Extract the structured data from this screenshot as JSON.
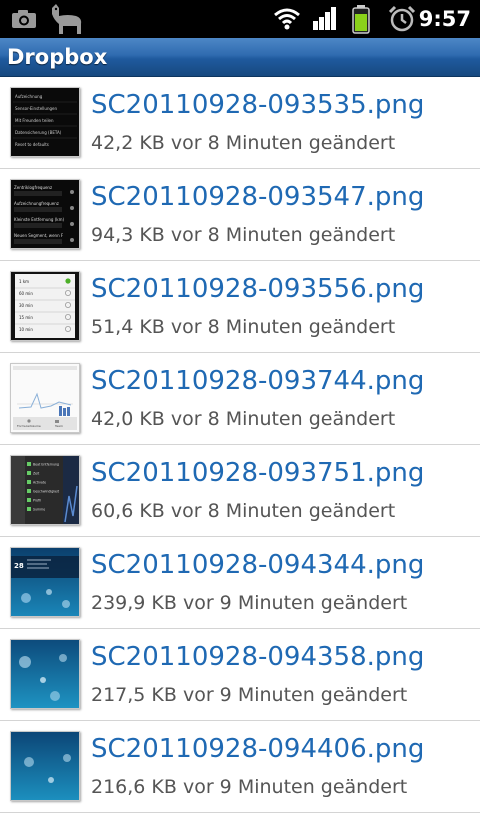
{
  "status_bar": {
    "time": "9:57",
    "icons": [
      "camera-icon",
      "alpaca-icon",
      "wifi-icon",
      "signal-icon",
      "battery-icon",
      "alarm-icon"
    ]
  },
  "app_bar": {
    "title": "Dropbox"
  },
  "files": [
    {
      "name": "SC20110928-093535.png",
      "info": "42,2 KB vor 8 Minuten geändert",
      "thumb_text": [
        "Aufzeichnung",
        "Sensor-Einstellungen",
        "Mit Freunden teilen",
        "Datensicherung (BETA)",
        "Reset to defaults"
      ]
    },
    {
      "name": "SC20110928-093547.png",
      "info": "94,3 KB vor 8 Minuten geändert",
      "thumb_text": [
        "Zentriklogfrequenz",
        "Aufzeichnungfrequenz",
        "Kleinste Entfernung (km)",
        "Neuen Segment, wenn F"
      ]
    },
    {
      "name": "SC20110928-093556.png",
      "info": "51,4 KB vor 8 Minuten geändert",
      "thumb_text": [
        "1 km",
        "60 min",
        "30 min",
        "15 min",
        "10 min"
      ]
    },
    {
      "name": "SC20110928-093744.png",
      "info": "42,0 KB vor 8 Minuten geändert",
      "thumb_text": [
        "Formularbäume",
        "Team"
      ]
    },
    {
      "name": "SC20110928-093751.png",
      "info": "60,6 KB vor 8 Minuten geändert",
      "thumb_text": [
        "Beat Entfernung",
        "Zeit",
        "Activate",
        "Geschwindigkeit",
        "Profil",
        "Summe"
      ]
    },
    {
      "name": "SC20110928-094344.png",
      "info": "239,9 KB vor 9 Minuten geändert",
      "thumb_text": [
        "28"
      ]
    },
    {
      "name": "SC20110928-094358.png",
      "info": "217,5 KB vor 9 Minuten geändert",
      "thumb_text": []
    },
    {
      "name": "SC20110928-094406.png",
      "info": "216,6 KB vor 9 Minuten geändert",
      "thumb_text": []
    }
  ],
  "colors": {
    "title_bar": "#2f6bb0",
    "file_name": "#1f69b3",
    "meta": "#555555"
  }
}
